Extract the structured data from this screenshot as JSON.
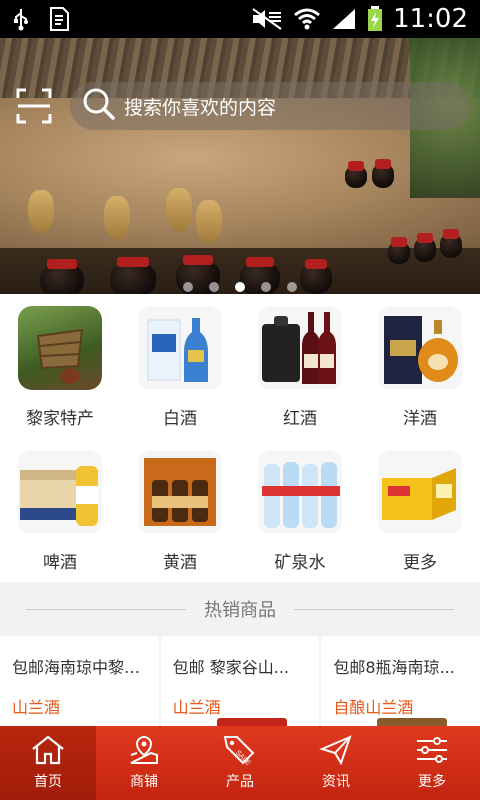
{
  "status_bar": {
    "time": "11:02"
  },
  "search": {
    "placeholder": "搜索你喜欢的内容"
  },
  "banner": {
    "slide_count": 5,
    "active_slide": 3
  },
  "categories": [
    {
      "label": "黎家特产",
      "icon": "lijia-specialty-image"
    },
    {
      "label": "白酒",
      "icon": "baijiu-bottle-image"
    },
    {
      "label": "红酒",
      "icon": "red-wine-image"
    },
    {
      "label": "洋酒",
      "icon": "foreign-liquor-image"
    },
    {
      "label": "啤酒",
      "icon": "beer-image"
    },
    {
      "label": "黄酒",
      "icon": "yellow-wine-image"
    },
    {
      "label": "矿泉水",
      "icon": "mineral-water-image"
    },
    {
      "label": "更多",
      "icon": "more-image"
    }
  ],
  "hot": {
    "title": "热销商品"
  },
  "products": [
    {
      "name": "包邮海南琼中黎家自...",
      "subtitle": "山兰酒"
    },
    {
      "name": "包邮 黎家谷山...",
      "subtitle": "山兰酒"
    },
    {
      "name": "包邮8瓶海南琼...",
      "subtitle": "自酿山兰酒"
    }
  ],
  "tabs": [
    {
      "label": "首页",
      "icon": "home-icon",
      "active": true
    },
    {
      "label": "商铺",
      "icon": "shop-map-icon",
      "active": false
    },
    {
      "label": "产品",
      "icon": "sale-tag-icon",
      "active": false
    },
    {
      "label": "资讯",
      "icon": "paper-plane-icon",
      "active": false
    },
    {
      "label": "更多",
      "icon": "sliders-icon",
      "active": false
    }
  ],
  "colors": {
    "accent": "#d8311a",
    "price": "#e8591a",
    "tab_active": "#a81f0b"
  }
}
